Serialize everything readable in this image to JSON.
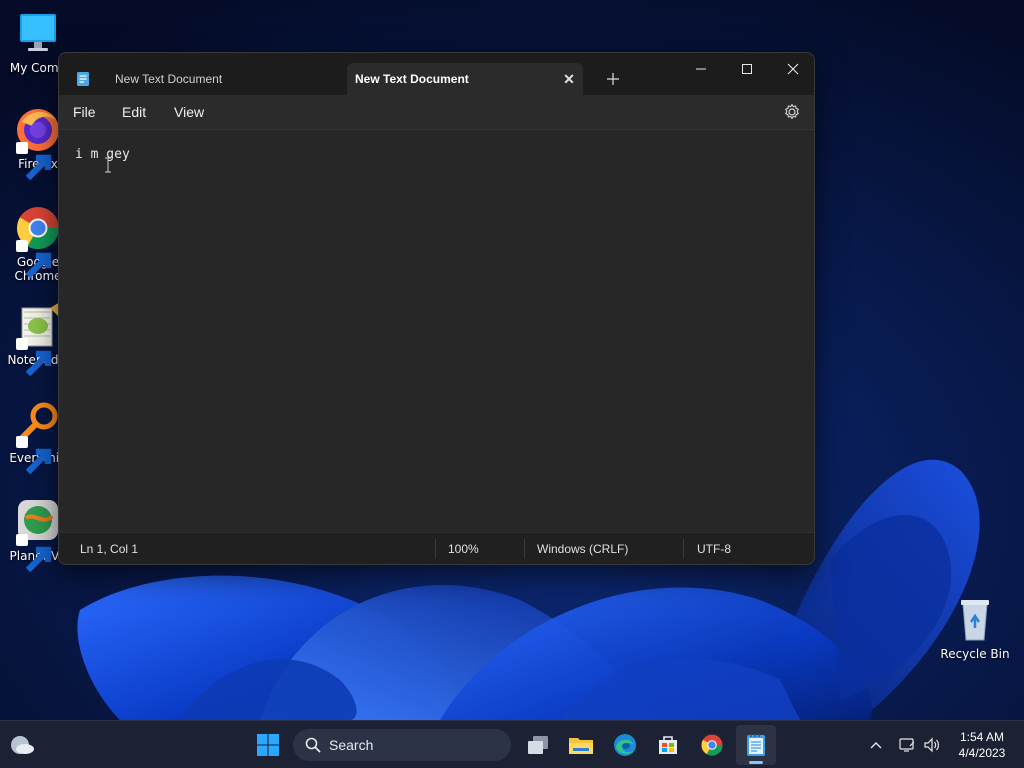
{
  "desktop": {
    "icons": [
      {
        "label": "My Comp",
        "icon": "computer-icon"
      },
      {
        "label": "Firefox",
        "icon": "firefox-icon"
      },
      {
        "label": "Google",
        "label2": "Chrome",
        "icon": "chrome-icon"
      },
      {
        "label": "Notepad+",
        "icon": "notepad-plus-plus-icon"
      },
      {
        "label": "Everythin",
        "icon": "everything-search-icon"
      },
      {
        "label": "Planet VP",
        "icon": "planet-vpn-icon"
      },
      {
        "label": "Recycle Bin",
        "icon": "recycle-bin-icon"
      }
    ]
  },
  "window": {
    "tabs": [
      {
        "title": "New Text Document",
        "active": false
      },
      {
        "title": "New Text Document",
        "active": true,
        "close": "✕"
      }
    ],
    "new_tab": "+",
    "controls": {
      "minimize": "minimize-icon",
      "maximize": "maximize-icon",
      "close": "close-icon"
    },
    "menu": {
      "file": "File",
      "edit": "Edit",
      "view": "View"
    },
    "editor": {
      "text": "i m gey"
    },
    "status": {
      "position": "Ln 1, Col 1",
      "zoom": "100%",
      "line_ending": "Windows (CRLF)",
      "encoding": "UTF-8"
    }
  },
  "taskbar": {
    "search": {
      "placeholder": "Search"
    },
    "apps": [
      "start-icon",
      "task-view-icon",
      "file-explorer-icon",
      "edge-icon",
      "store-icon",
      "chrome-icon",
      "notepad-icon"
    ],
    "tray": [
      "chevron-up-icon",
      "network-icon",
      "volume-icon"
    ],
    "clock": {
      "time": "1:54 AM",
      "date": "4/4/2023"
    }
  },
  "colors": {
    "window_bg": "#202020",
    "editor_bg": "#272727",
    "taskbar_bg": "#1c2233",
    "accent": "#0078d4"
  }
}
